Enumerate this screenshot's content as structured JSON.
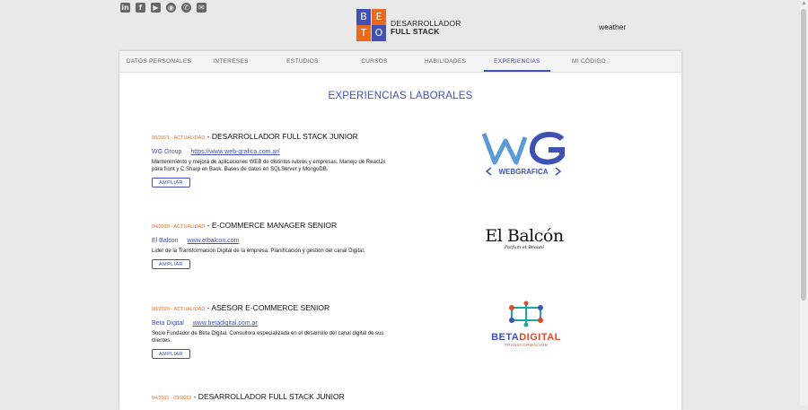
{
  "socials": [
    {
      "icon": "linkedin-icon",
      "glyph": "in"
    },
    {
      "icon": "facebook-icon",
      "glyph": "f"
    },
    {
      "icon": "youtube-icon",
      "glyph": "▶"
    },
    {
      "icon": "github-icon",
      "glyph": "◉"
    },
    {
      "icon": "whatsapp-icon",
      "glyph": "✆"
    },
    {
      "icon": "mail-icon",
      "glyph": "✉"
    }
  ],
  "logo": {
    "letters": [
      "B",
      "E",
      "T",
      "O"
    ],
    "colors": [
      "#3f51b5",
      "#e96a1c",
      "#e96a1c",
      "#3f51b5"
    ],
    "line1": "DESARROLLADOR",
    "line2": "FULL STACK"
  },
  "weather": "weather",
  "tabs": [
    "DATOS PERSONALES",
    "INTERESES",
    "ESTUDIOS",
    "CURSOS",
    "HABILIDADES",
    "EXPERIENCIAS",
    "MI CÓDIGO"
  ],
  "active_tab": "EXPERIENCIAS",
  "section_title": "EXPERIENCIAS LABORALES",
  "experiences": [
    {
      "date": "08/2021 - ACTUALIDAD",
      "role": " - DESARROLLADOR FULL STACK JUNIOR",
      "company": "WG Group",
      "link": "https://www.web-grafica.com.ar/",
      "desc": "Mantenimiento y mejora de aplicaciones WEB de distintos rubros y empresas. Manejo de ReactJs para front y C Sharp en Back. Bases de datos en SQLServer y MongoDB.",
      "button": "AMPLIAR"
    },
    {
      "date": "04/2019 - ACTUALIDAD",
      "role": " - E-COMMERCE MANAGER SENIOR",
      "company": "El Balcon",
      "link": "www.elbalcon.com",
      "desc": "Lider de la Transformación Digital de la empresa. Planificación y gestión del canal Digital.",
      "button": "AMPLIAR"
    },
    {
      "date": "08/2020 - ACTUALIDAD",
      "role": " - ASESOR E-COMMERCE SENIOR",
      "company": "Beta Digital",
      "link": "www.betadigital.com.ar",
      "desc": "Socio Fundador de Beta Digital. Consultora especializada en el desarrollo del canal digital de sus clientes.",
      "button": "AMPLIAR"
    },
    {
      "date": "04/2011 - 03/2012",
      "role": " - DESARROLLADOR FULL STACK JUNIOR",
      "company": "",
      "link": "",
      "desc": "",
      "button": ""
    }
  ],
  "company_logos": {
    "wg": {
      "text": "WEBGRAFICA",
      "colors": {
        "w": "#5a9bd5",
        "g": "#3f51b5"
      }
    },
    "balcon": {
      "main": "El Balcón",
      "sub": "Parfum et Beauté"
    },
    "beta": {
      "beta": "BETA",
      "digital": "DIGITAL",
      "sub": "TRANSFORMACIÓN",
      "colors": {
        "beta": "#3f51b5",
        "digital": "#e04a2a",
        "icon": "#1aa7a0"
      }
    }
  }
}
